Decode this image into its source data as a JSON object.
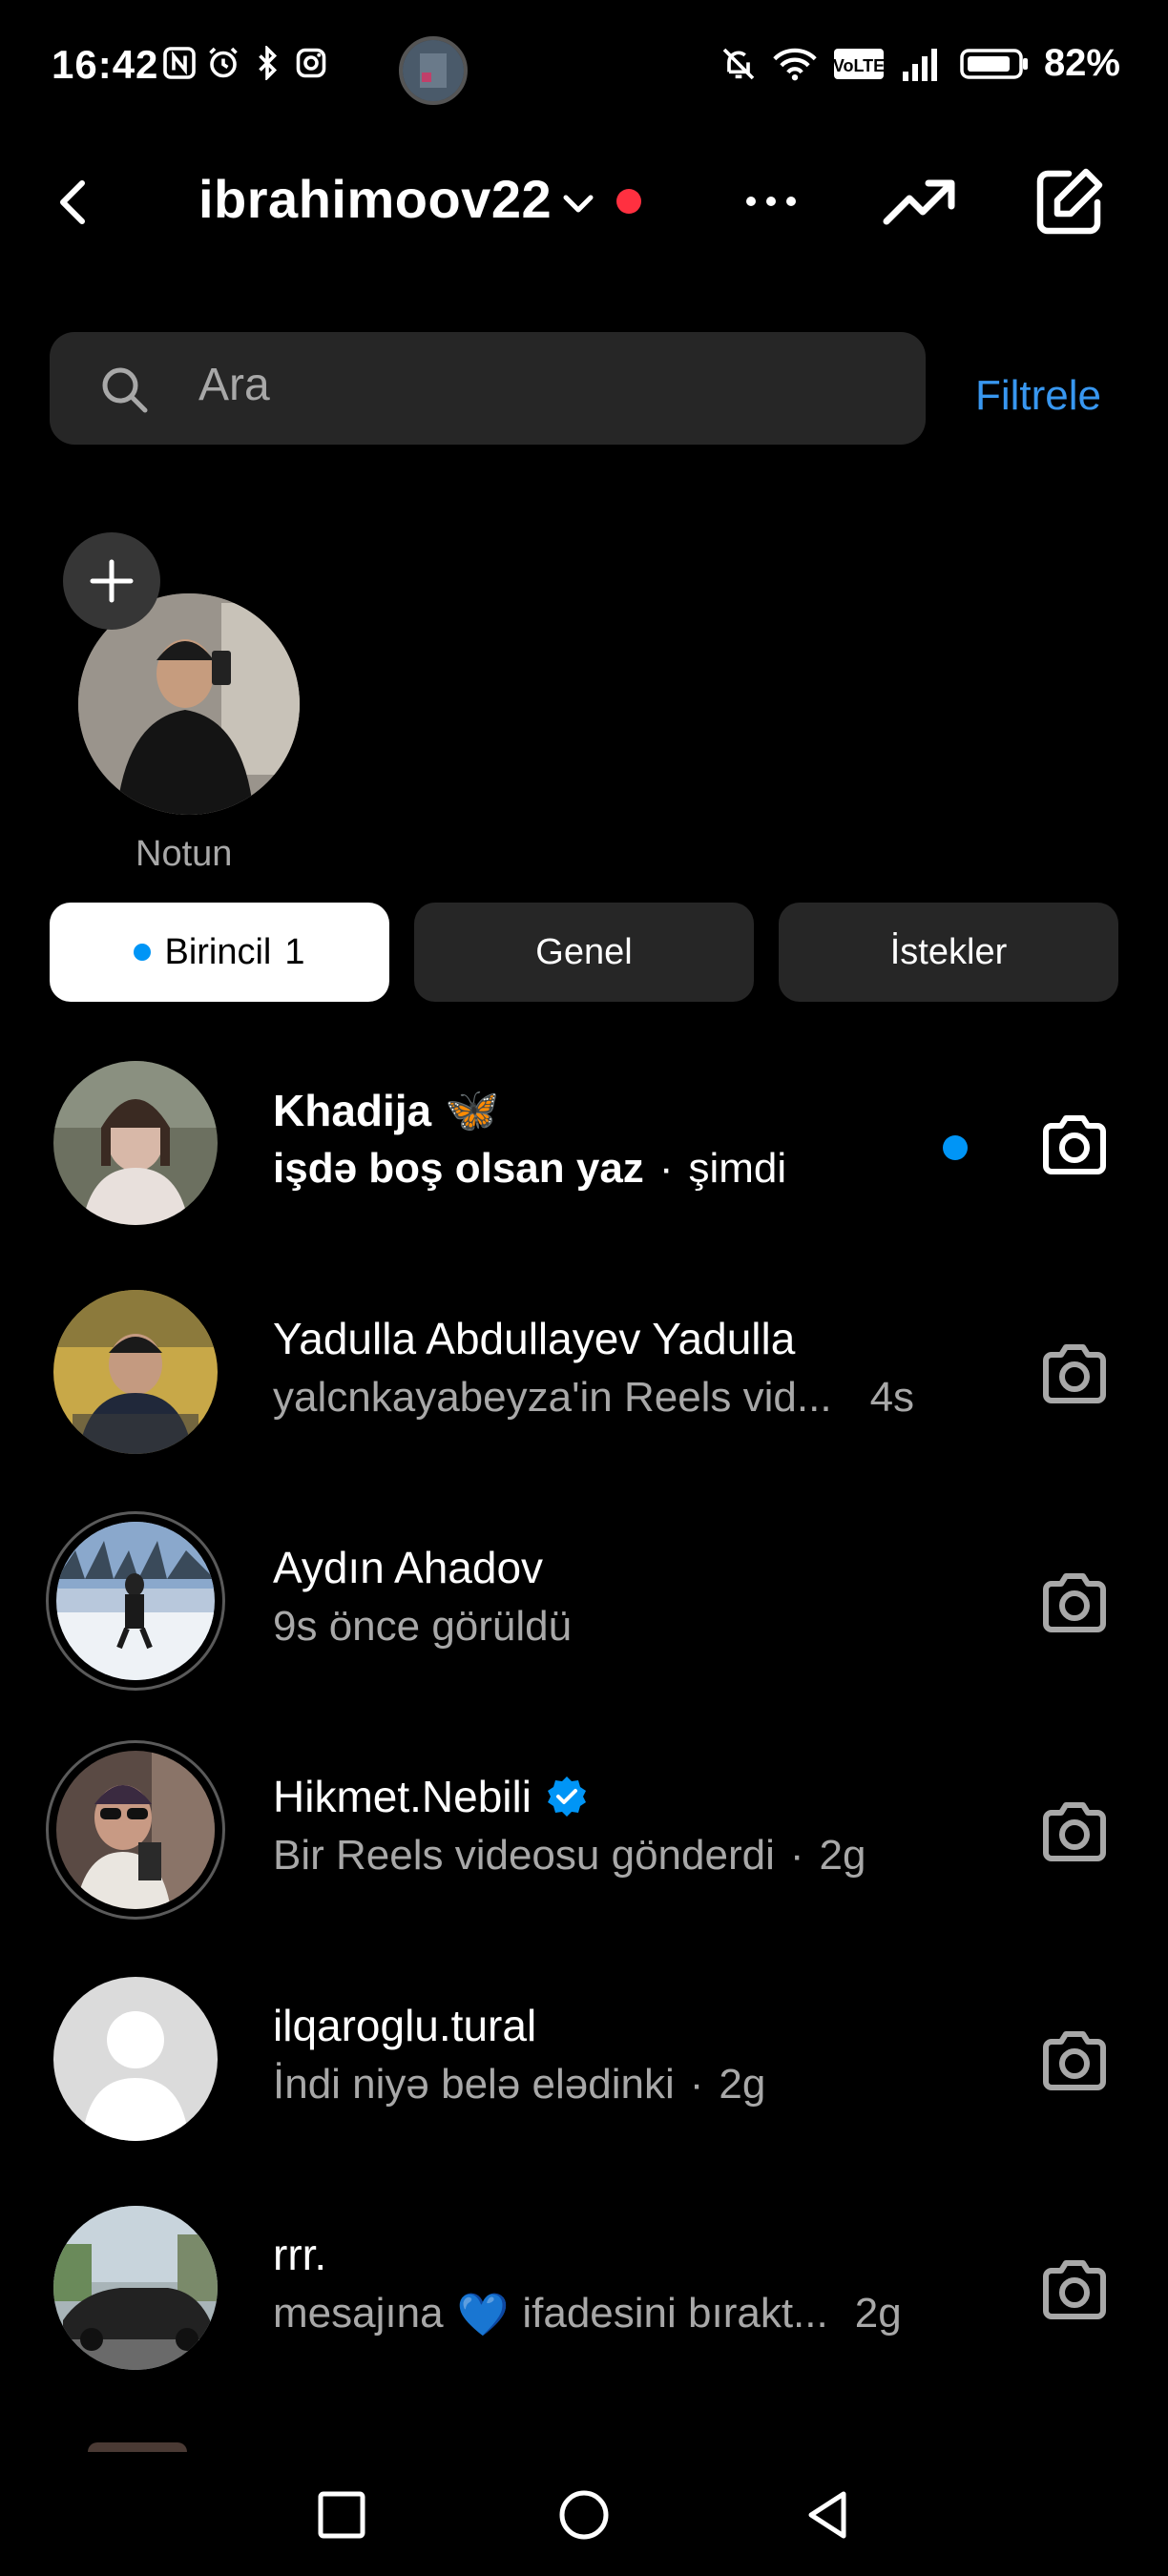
{
  "status_bar": {
    "time": "16:42",
    "battery": "82%"
  },
  "header": {
    "username": "ibrahimoov22"
  },
  "search": {
    "placeholder": "Ara",
    "filter_label": "Filtrele"
  },
  "note": {
    "label": "Notun"
  },
  "tabs": [
    {
      "label": "Birincil",
      "count": "1",
      "active": true
    },
    {
      "label": "Genel",
      "active": false
    },
    {
      "label": "İstekler",
      "active": false
    }
  ],
  "conversations": [
    {
      "name": "Khadija",
      "emoji": "🦋",
      "message": "işdə boş olsan yaz",
      "time": "şimdi",
      "unread": true
    },
    {
      "name": "Yadulla Abdullayev Yadulla",
      "message": "yalcnkayabeyza'in Reels vid...",
      "time": "4s"
    },
    {
      "name": "Aydın Ahadov",
      "message": "9s önce görüldü",
      "time": ""
    },
    {
      "name": "Hikmet.Nebili",
      "verified": true,
      "message": "Bir Reels videosu gönderdi",
      "time": "2g"
    },
    {
      "name": "ilqaroglu.tural",
      "message": "İndi niyə belə elədinki",
      "time": "2g"
    },
    {
      "name": "rrr.",
      "message_pre": "mesajına",
      "message_emoji": "💙",
      "message_post": "ifadesini bırakt...",
      "time": "2g"
    }
  ],
  "colors": {
    "accent": "#0095f6",
    "link": "#3897f0",
    "red_dot": "#ff3040",
    "background": "#000000",
    "surface": "#262626",
    "muted_text": "#a8a8a8"
  }
}
